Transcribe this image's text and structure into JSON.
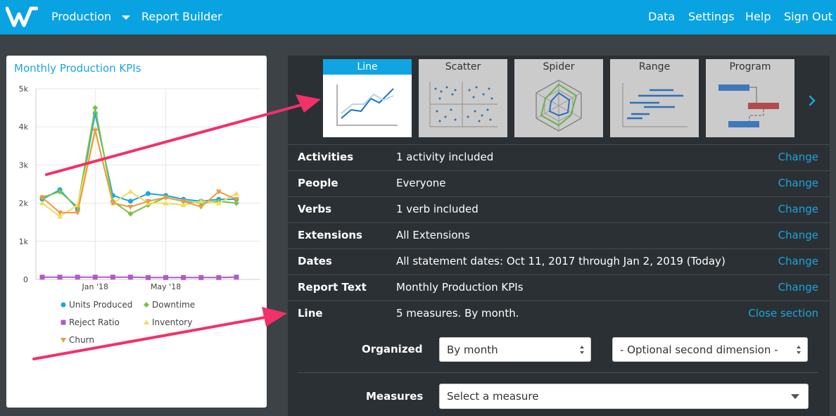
{
  "nav": {
    "logo_icon": "w-logo-icon",
    "app_name": "Production",
    "report_builder": "Report Builder",
    "links": [
      "Data",
      "Settings",
      "Help",
      "Sign Out"
    ]
  },
  "colors": {
    "brand": "#0aa3e2",
    "link": "#1aa6de",
    "panel_bg": "#2b3034",
    "arrow": "#f2306a"
  },
  "card": {
    "title": "Monthly Production KPIs"
  },
  "chart_data": {
    "type": "line",
    "title": "Monthly Production KPIs",
    "ylim": [
      0,
      5000
    ],
    "yticks": [
      "0",
      "1k",
      "2k",
      "3k",
      "4k",
      "5k"
    ],
    "xticks": [
      "Jan '18",
      "May '18"
    ],
    "x": [
      "Oct 2017",
      "Nov 2017",
      "Dec 2017",
      "Jan 2018",
      "Feb 2018",
      "Mar 2018",
      "Apr 2018",
      "May 2018",
      "Jun 2018",
      "Jul 2018",
      "Aug 2018",
      "Sep 2018",
      "Oct 2018"
    ],
    "grid": true,
    "legend_position": "bottom",
    "series": [
      {
        "name": "Units Produced",
        "color": "#1aa6de",
        "marker": "circle",
        "values": [
          2100,
          2350,
          1850,
          4350,
          2200,
          2050,
          2250,
          2200,
          2100,
          2050,
          2100,
          2100,
          null
        ]
      },
      {
        "name": "Downtime",
        "color": "#7ac24b",
        "marker": "diamond",
        "values": [
          2150,
          2300,
          1900,
          4500,
          2050,
          1720,
          1950,
          2150,
          2050,
          2000,
          2050,
          2000,
          null
        ]
      },
      {
        "name": "Reject Ratio",
        "color": "#b15bc6",
        "marker": "square",
        "values": [
          60,
          60,
          60,
          60,
          60,
          60,
          50,
          50,
          50,
          50,
          50,
          60,
          null
        ]
      },
      {
        "name": "Inventory",
        "color": "#f2dc5d",
        "marker": "triangle-up",
        "values": [
          2000,
          1650,
          1950,
          3950,
          2000,
          2300,
          2000,
          2000,
          1950,
          2050,
          2000,
          2250,
          null
        ]
      },
      {
        "name": "Churn",
        "color": "#ee9b3c",
        "marker": "triangle-down",
        "values": [
          2150,
          1750,
          1750,
          3900,
          2000,
          1900,
          2050,
          2150,
          2050,
          1900,
          2300,
          2100,
          null
        ]
      }
    ]
  },
  "chart_types": [
    {
      "label": "Line",
      "icon": "line-chart-icon",
      "active": true
    },
    {
      "label": "Scatter",
      "icon": "scatter-chart-icon",
      "active": false
    },
    {
      "label": "Spider",
      "icon": "spider-chart-icon",
      "active": false
    },
    {
      "label": "Range",
      "icon": "range-chart-icon",
      "active": false
    },
    {
      "label": "Program",
      "icon": "program-chart-icon",
      "active": false
    }
  ],
  "rows": [
    {
      "label": "Activities",
      "value": "1 activity included",
      "action": "Change"
    },
    {
      "label": "People",
      "value": "Everyone",
      "action": "Change"
    },
    {
      "label": "Verbs",
      "value": "1 verb included",
      "action": "Change"
    },
    {
      "label": "Extensions",
      "value": "All Extensions",
      "action": "Change"
    },
    {
      "label": "Dates",
      "value": "All statement dates: Oct 11, 2017 through Jan 2, 2019 (Today)",
      "action": "Change"
    },
    {
      "label": "Report Text",
      "value": "Monthly Production KPIs",
      "action": "Change"
    },
    {
      "label": "Line",
      "value": "5 measures. By month.",
      "action": "Close section"
    }
  ],
  "form": {
    "organized_label": "Organized",
    "organized_value": "By month",
    "second_dimension": "- Optional second dimension -",
    "measures_label": "Measures",
    "measures_placeholder": "Select a measure"
  }
}
